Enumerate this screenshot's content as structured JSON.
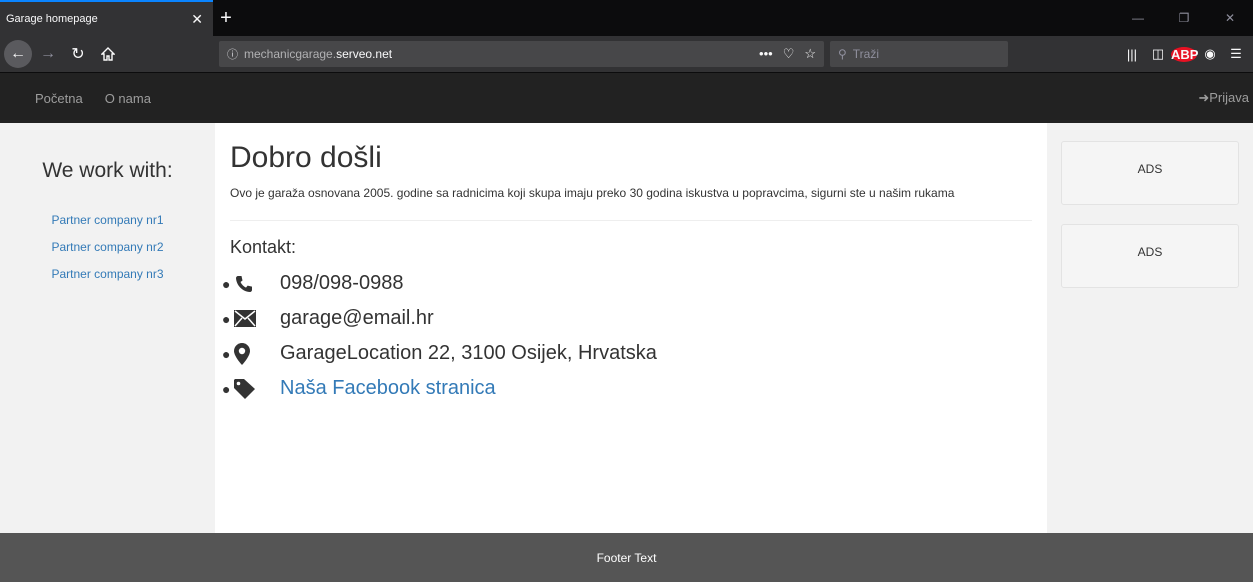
{
  "browser": {
    "tab_title": "Garage homepage",
    "tab_close": "✕",
    "new_tab": "+",
    "url_prefix": "mechanicgarage.",
    "url_domain": "serveo.net",
    "search_placeholder": "Traži",
    "url_more": "•••"
  },
  "site": {
    "nav": {
      "home": "Početna",
      "about": "O nama",
      "login": "Prijava"
    },
    "left": {
      "heading": "We work with:",
      "partners": [
        "Partner company nr1",
        "Partner company nr2",
        "Partner company nr3"
      ]
    },
    "main": {
      "title": "Dobro došli",
      "intro": "Ovo je garaža osnovana 2005. godine sa radnicima koji skupa imaju preko 30 godina iskustva u popravcima, sigurni ste u našim rukama",
      "contact_heading": "Kontakt:",
      "contacts": [
        {
          "icon": "phone-icon",
          "text": "098/098-0988"
        },
        {
          "icon": "envelope-icon",
          "text": "garage@email.hr"
        },
        {
          "icon": "map-marker-icon",
          "text": "GarageLocation 22, 3100 Osijek, Hrvatska"
        },
        {
          "icon": "tag-icon",
          "text": "Naša Facebook stranica"
        }
      ]
    },
    "right": {
      "ads": [
        "ADS",
        "ADS"
      ]
    },
    "footer": "Footer Text"
  },
  "colors": {
    "link": "#337ab7",
    "navbar": "#222222",
    "footer": "#555555"
  }
}
